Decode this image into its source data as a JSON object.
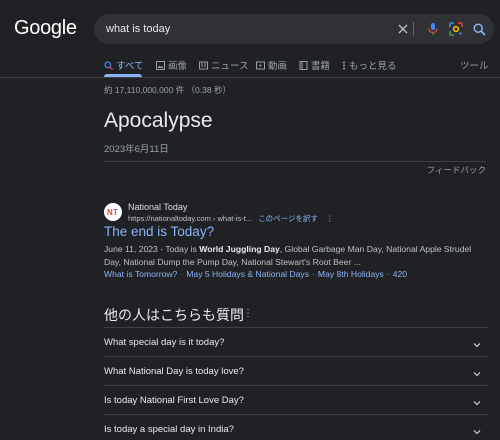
{
  "header": {
    "logo": "Google",
    "search_value": "what is today"
  },
  "tabs": [
    {
      "label": "すべて",
      "icon": "search-icon",
      "active": true
    },
    {
      "label": "画像",
      "icon": "image-icon"
    },
    {
      "label": "ニュース",
      "icon": "news-icon"
    },
    {
      "label": "動画",
      "icon": "video-icon"
    },
    {
      "label": "書籍",
      "icon": "book-icon"
    },
    {
      "label": "もっと見る",
      "icon": "more-vert-icon"
    },
    {
      "label": "ツール",
      "icon": ""
    }
  ],
  "stats": "約 17,110,000,000 件 （0.38 秒）",
  "answer": {
    "title": "Apocalypse",
    "date": "2023年6月11日",
    "feedback": "フィードバック"
  },
  "result": {
    "site_name": "National Today",
    "url": "https://nationaltoday.com › what-is-t...",
    "translate": "このページを訳す",
    "title": "The end is Today?",
    "snippet_pre": "June 11, 2023 - Today is ",
    "snippet_bold": "World Juggling Day",
    "snippet_post": ", Global Garbage Man Day, National Apple Strudel Day, National Dump the Pump Day, National Stewart's Root Beer ...",
    "sitelinks": [
      "What is Tomorrow?",
      "May 5 Holidays & National Days",
      "May 8th Holidays",
      "420"
    ]
  },
  "paa": {
    "title": "他の人はこちらも質問",
    "questions": [
      "What special day is it today?",
      "What National Day is today love?",
      "Is today National First Love Day?",
      "Is today a special day in India?"
    ]
  },
  "colors": {
    "background": "#202124",
    "link": "#8ab4f8",
    "text": "#bdc1c6"
  }
}
